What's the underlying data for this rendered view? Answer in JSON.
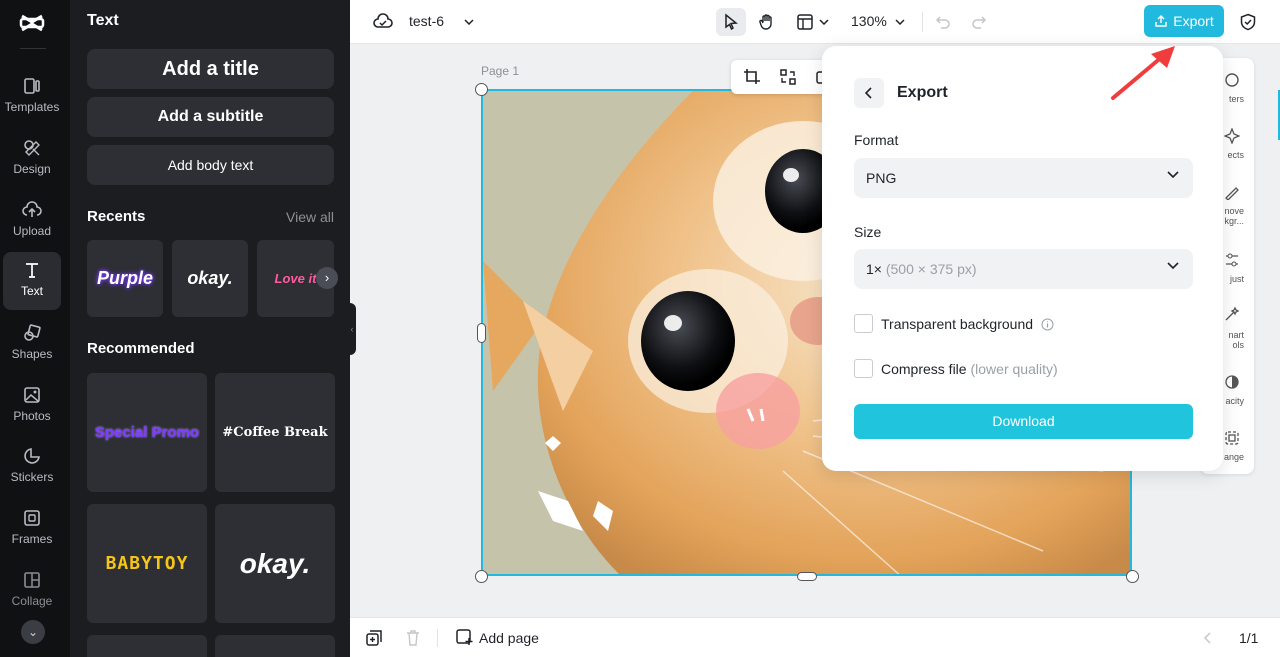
{
  "colors": {
    "accent": "#21b9de",
    "download": "#21c4dd",
    "rail_bg": "#101113",
    "panel_bg": "#1c1d21",
    "arrow": "#f03c3c"
  },
  "rail": {
    "items": [
      {
        "label": "Templates",
        "icon": "templates-icon"
      },
      {
        "label": "Design",
        "icon": "design-icon"
      },
      {
        "label": "Upload",
        "icon": "upload-icon"
      },
      {
        "label": "Text",
        "icon": "text-icon",
        "active": true
      },
      {
        "label": "Shapes",
        "icon": "shapes-icon"
      },
      {
        "label": "Photos",
        "icon": "photos-icon"
      },
      {
        "label": "Stickers",
        "icon": "stickers-icon"
      },
      {
        "label": "Frames",
        "icon": "frames-icon"
      },
      {
        "label": "Collage",
        "icon": "collage-icon"
      }
    ]
  },
  "panel": {
    "title": "Text",
    "add_title": "Add a title",
    "add_subtitle": "Add a subtitle",
    "add_body": "Add body text",
    "recents_label": "Recents",
    "view_all": "View all",
    "recents": [
      "Purple",
      "okay.",
      "Love it"
    ],
    "recommended_label": "Recommended",
    "recommended": [
      "Special Promo",
      "#Coffee Break",
      "BABYTOY",
      "okay."
    ]
  },
  "topbar": {
    "project_name": "test-6",
    "zoom": "130%",
    "export_label": "Export"
  },
  "canvas": {
    "page_label": "Page 1"
  },
  "right_tools": [
    "ters",
    "ects",
    "nove\nkgr...",
    "just",
    "nart\nols",
    "acity",
    "ange"
  ],
  "export_dialog": {
    "title": "Export",
    "format_label": "Format",
    "format_value": "PNG",
    "size_label": "Size",
    "size_multiplier": "1×",
    "size_dims": "(500 × 375 px)",
    "transparent_label": "Transparent background",
    "compress_label": "Compress file",
    "compress_hint": "(lower quality)",
    "download_label": "Download"
  },
  "bottombar": {
    "add_page": "Add page",
    "page_count": "1/1"
  }
}
